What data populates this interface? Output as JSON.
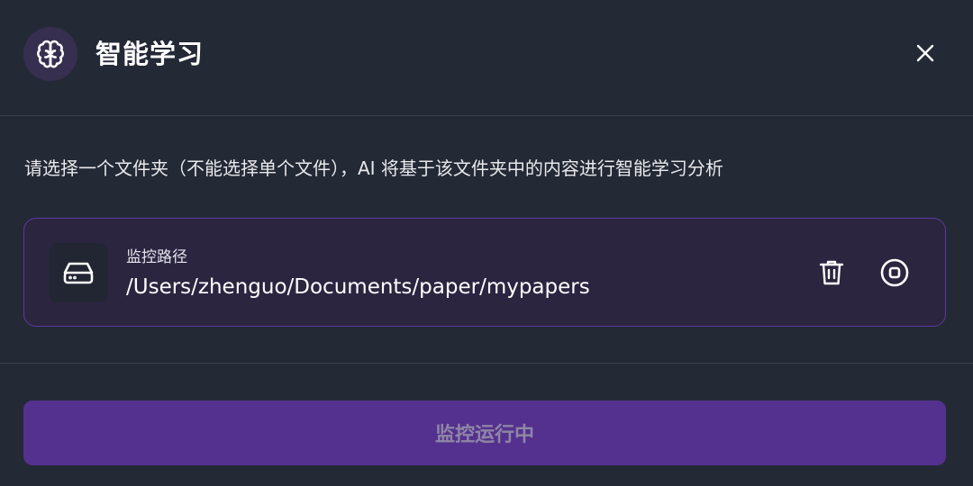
{
  "header": {
    "title": "智能学习",
    "icon": "brain-icon",
    "close_icon": "close-icon"
  },
  "description": "请选择一个文件夹（不能选择单个文件），AI 将基于该文件夹中的内容进行智能学习分析",
  "folder": {
    "label": "监控路径",
    "path": "/Users/zhenguo/Documents/paper/mypapers",
    "drive_icon": "hard-drive-icon",
    "delete_icon": "trash-icon",
    "stop_icon": "stop-circle-icon"
  },
  "action": {
    "label": "监控运行中",
    "state": "disabled"
  },
  "colors": {
    "background": "#242936",
    "accent": "#54318e",
    "card_border": "#5c3a9e",
    "card_background": "#2b2540"
  }
}
